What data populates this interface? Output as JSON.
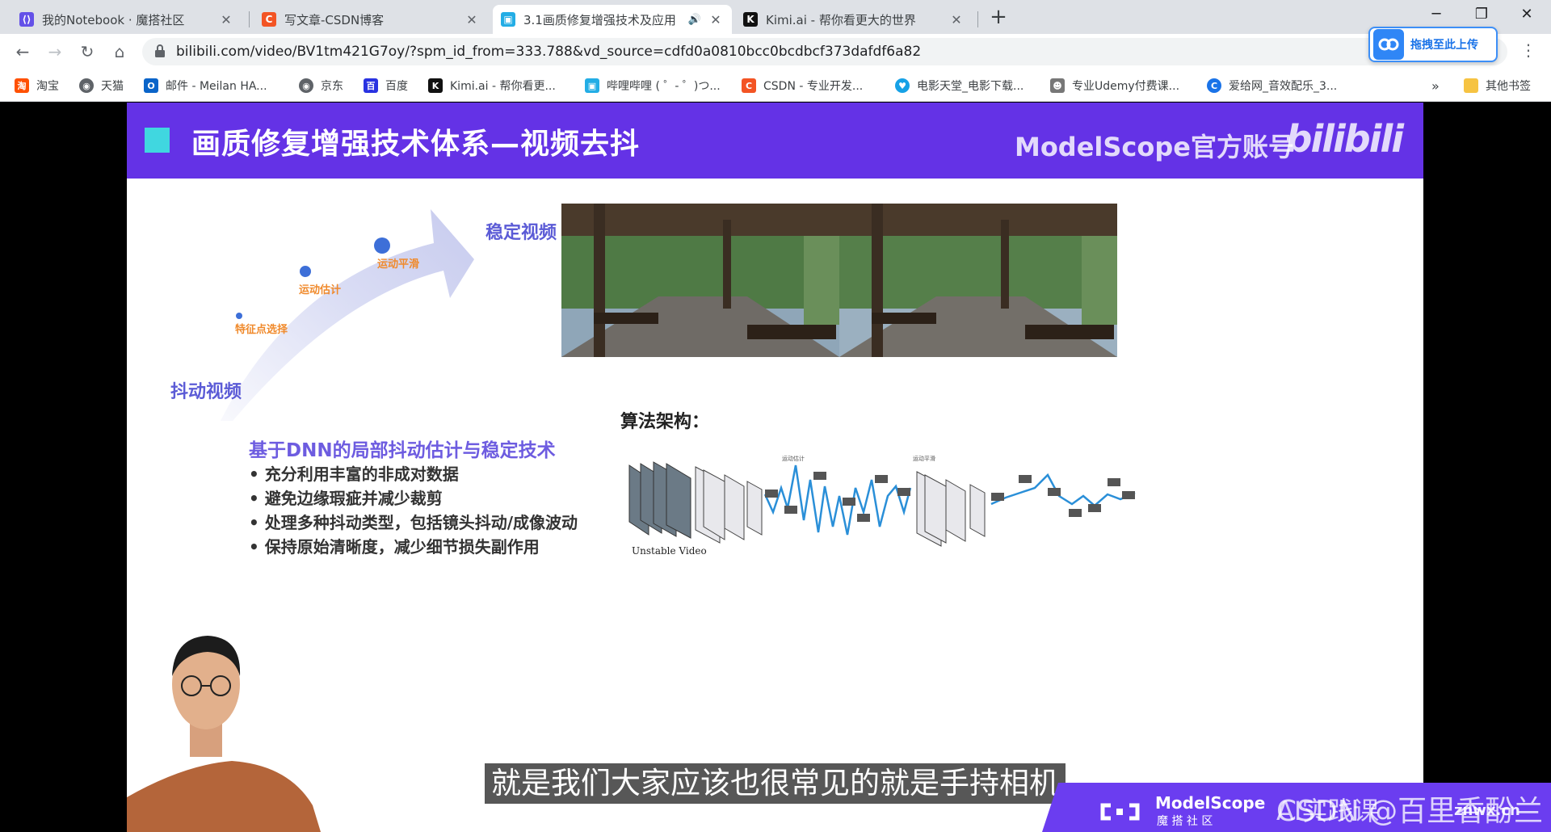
{
  "tabs": [
    {
      "title": "我的Notebook · 魔搭社区",
      "icon": "modelscope-icon",
      "color": "#6451e8"
    },
    {
      "title": "写文章-CSDN博客",
      "icon": "csdn-icon",
      "color": "#f35424"
    },
    {
      "title": "3.1画质修复增强技术及应用",
      "icon": "bilibili-icon",
      "color": "#23ade5",
      "active": true
    },
    {
      "title": "Kimi.ai - 帮你看更大的世界",
      "icon": "kimi-icon",
      "color": "#111111"
    }
  ],
  "window_controls": {
    "minimize": "─",
    "restore": "❐",
    "close": "✕",
    "new_tab": "+"
  },
  "address": {
    "url": "bilibili.com/video/BV1tm421G7oy/?spm_id_from=333.788&vd_source=cdfd0a0810bcc0bcdbcf373dafdf6a82"
  },
  "upload_button": {
    "label": "拖拽至此上传"
  },
  "bookmarks": [
    {
      "label": "淘宝",
      "icon": "taobao-icon",
      "color": "#ff5000"
    },
    {
      "label": "天猫",
      "icon": "globe-icon",
      "color": "#5f6368"
    },
    {
      "label": "邮件 - Meilan HA...",
      "icon": "outlook-icon",
      "color": "#0a64c9"
    },
    {
      "label": "京东",
      "icon": "globe-icon",
      "color": "#5f6368"
    },
    {
      "label": "百度",
      "icon": "baidu-icon",
      "color": "#2932e1"
    },
    {
      "label": "Kimi.ai - 帮你看更...",
      "icon": "kimi-icon",
      "color": "#111111"
    },
    {
      "label": "哔哩哔哩 ( ゜- ゜)つ...",
      "icon": "bilibili-icon",
      "color": "#23ade5"
    },
    {
      "label": "CSDN - 专业开发...",
      "icon": "csdn-icon",
      "color": "#f35424"
    },
    {
      "label": "电影天堂_电影下载...",
      "icon": "heart-icon",
      "color": "#16a1e6"
    },
    {
      "label": "专业Udemy付费课...",
      "icon": "people-icon",
      "color": "#777777"
    },
    {
      "label": "爱给网_音效配乐_3...",
      "icon": "aigei-icon",
      "color": "#1a73e8"
    },
    {
      "label": "其他书签",
      "icon": "folder-icon",
      "color": "#f6c342"
    }
  ],
  "bookmarks_more": "»",
  "slide": {
    "title": "画质修复增强技术体系—视频去抖",
    "account": "ModelScope官方账号",
    "logo_text": "bilibili",
    "stable_label": "稳定视频",
    "shaky_label": "抖动视频",
    "stages": [
      "特征点选择",
      "运动估计",
      "运动平滑"
    ],
    "subtitle": "基于DNN的局部抖动估计与稳定技术",
    "bullets": [
      "充分利用丰富的非成对数据",
      "避免边缘瑕疵并减少裁剪",
      "处理多种抖动类型，包括镜头抖动/成像波动",
      "保持原始清晰度，减少细节损失副作用"
    ],
    "algo_label": "算法架构：",
    "unstable_label": "Unstable Video",
    "arch_labels": [
      "运动估计",
      "运动平滑"
    ]
  },
  "caption": "就是我们大家应该也很常见的就是手持相机",
  "banner": {
    "brand": "ModelScope",
    "brand_sub": "魔 搭 社 区",
    "text": "AI实践课"
  },
  "watermark": "CSDN @百里香酚兰",
  "site_mark": "znwx.cn"
}
